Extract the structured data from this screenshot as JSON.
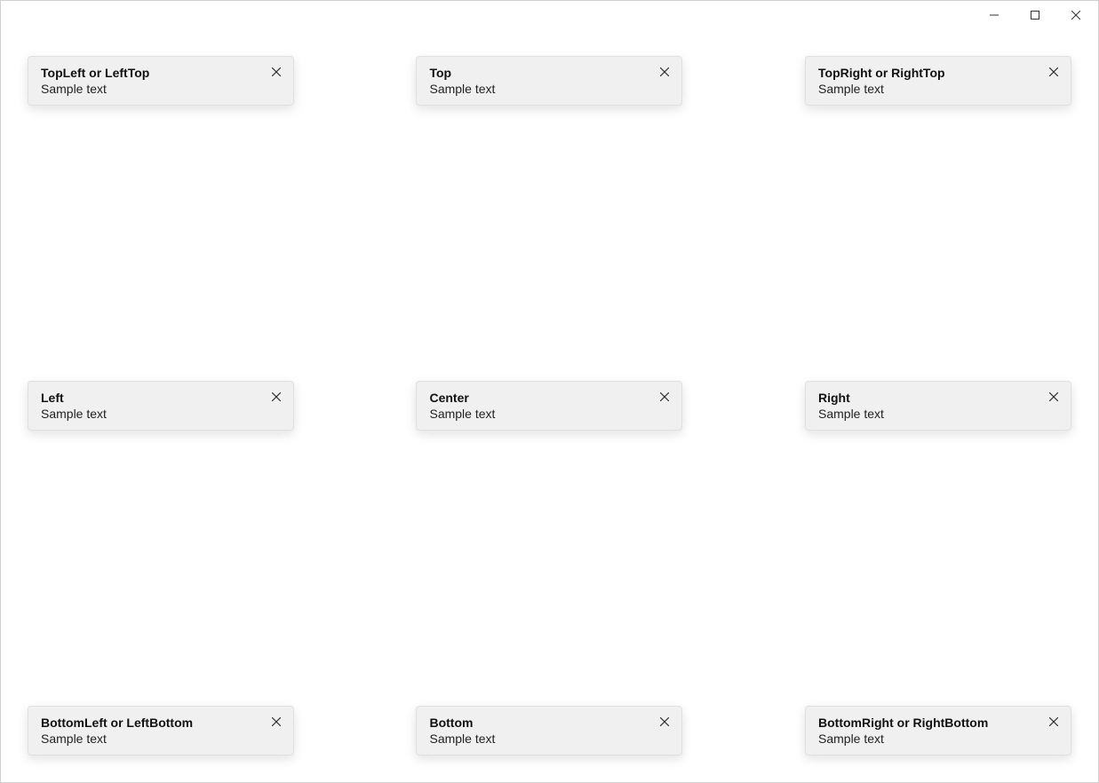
{
  "window": {
    "title": ""
  },
  "cards": {
    "topLeft": {
      "title": "TopLeft or LeftTop",
      "body": "Sample text"
    },
    "top": {
      "title": "Top",
      "body": "Sample text"
    },
    "topRight": {
      "title": "TopRight or RightTop",
      "body": "Sample text"
    },
    "left": {
      "title": "Left",
      "body": "Sample text"
    },
    "center": {
      "title": "Center",
      "body": "Sample text"
    },
    "right": {
      "title": "Right",
      "body": "Sample text"
    },
    "bottomLeft": {
      "title": "BottomLeft or LeftBottom",
      "body": "Sample text"
    },
    "bottom": {
      "title": "Bottom",
      "body": "Sample text"
    },
    "bottomRight": {
      "title": "BottomRight or RightBottom",
      "body": "Sample text"
    }
  }
}
